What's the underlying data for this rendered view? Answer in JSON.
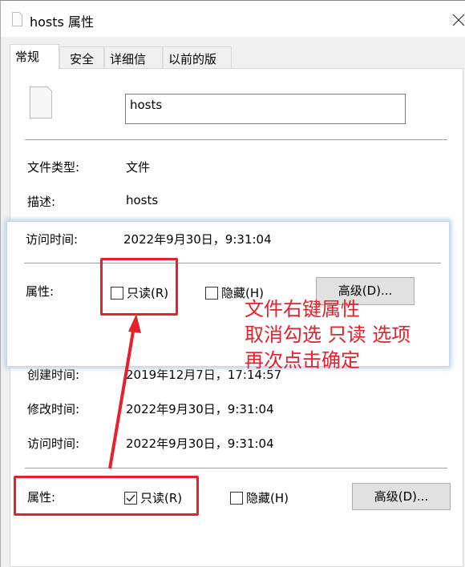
{
  "window": {
    "title": "hosts 属性",
    "close_icon": "close-icon"
  },
  "tabs": [
    {
      "label": "常规"
    },
    {
      "label": "安全"
    },
    {
      "label": "详细信息"
    },
    {
      "label": "以前的版本"
    }
  ],
  "file": {
    "icon": "file-icon",
    "name": "hosts"
  },
  "props": {
    "type_label": "文件类型:",
    "type_value": "文件",
    "desc_label": "描述:",
    "desc_value": "hosts",
    "created_label": "创建时间:",
    "created_value": "2019年12月7日，17:14:57",
    "modified_label": "修改时间:",
    "modified_value": "2022年9月30日，9:31:04",
    "accessed_label": "访问时间:",
    "accessed_value": "2022年9月30日，9:31:04"
  },
  "attributes": {
    "label": "属性:",
    "readonly_label": "只读(R)",
    "readonly_checked": true,
    "hidden_label": "隐藏(H)",
    "hidden_checked": false,
    "advanced_label": "高级(D)..."
  },
  "overlay": {
    "accessed_label": "访问时间:",
    "accessed_value": "2022年9月30日，9:31:04",
    "attr_label": "属性:",
    "readonly_label": "只读(R)",
    "readonly_checked": false,
    "hidden_label": "隐藏(H)",
    "hidden_checked": false,
    "advanced_label": "高级(D)..."
  },
  "annotation": {
    "lines": [
      "文件右键属性",
      "取消勾选 只读 选项",
      "再次点击确定"
    ],
    "color": "#e8202a"
  }
}
